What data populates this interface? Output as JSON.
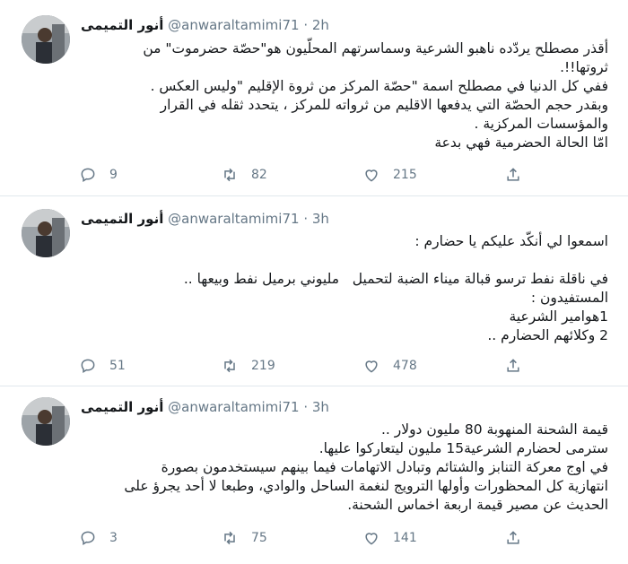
{
  "tweets": [
    {
      "author": {
        "name": "أنور التميمى",
        "handle": "@anwaraltamimi71",
        "separator": "·",
        "time": "2h"
      },
      "lines": [
        "أقذر مصطلح يردّده ناهبو الشرعية وسماسرتهم المحلّيون هو\"حصّة حضرموت\" من",
        "ثروتها!!.",
        "ففي كل الدنيا في مصطلح اسمة \"حصّة المركز من ثروة الإقليم \"وليس العكس .",
        "وبقدر حجم الحصّة التي يدفعها الاقليم من ثرواته للمركز ، يتحدد ثقله في القرار",
        "والمؤسسات المركزية .",
        "امّا الحالة الحضرمية فهي بدعة"
      ],
      "stats": {
        "replies": "9",
        "retweets": "82",
        "likes": "215"
      }
    },
    {
      "author": {
        "name": "أنور التميمى",
        "handle": "@anwaraltamimi71",
        "separator": "·",
        "time": "3h"
      },
      "lines": [
        "اسمعوا لي أنكّد عليكم يا حضارم :",
        "",
        "في ناقلة نفط ترسو قبالة ميناء الضبة لتحميل   مليوني برميل نفط وبيعها ..",
        "المستفيدون :",
        "1هوامير الشرعية",
        "2 وكلائهم الحضارم .."
      ],
      "stats": {
        "replies": "51",
        "retweets": "219",
        "likes": "478"
      }
    },
    {
      "author": {
        "name": "أنور التميمى",
        "handle": "@anwaraltamimi71",
        "separator": "·",
        "time": "3h"
      },
      "lines": [
        "قيمة الشحنة المنهوبة 80 مليون دولار ..",
        "سترمى لحضارم الشرعية15 مليون ليتعاركوا عليها.",
        "في اوج معركة التنابز والشتائم وتبادل الاتهامات فيما بينهم سيستخدمون بصورة",
        "انتهازية كل المحظورات وأولها الترويج لنغمة الساحل والوادي، وطبعا لا أحد يجرؤ على",
        "الحديث عن مصير قيمة اربعة اخماس الشحنة."
      ],
      "stats": {
        "replies": "3",
        "retweets": "75",
        "likes": "141"
      }
    }
  ],
  "icons": {
    "reply": "reply-icon",
    "retweet": "retweet-icon",
    "like": "like-icon",
    "share": "share-icon"
  },
  "colors": {
    "text": "#14171a",
    "muted": "#657786",
    "divider": "#e1e8ed"
  }
}
